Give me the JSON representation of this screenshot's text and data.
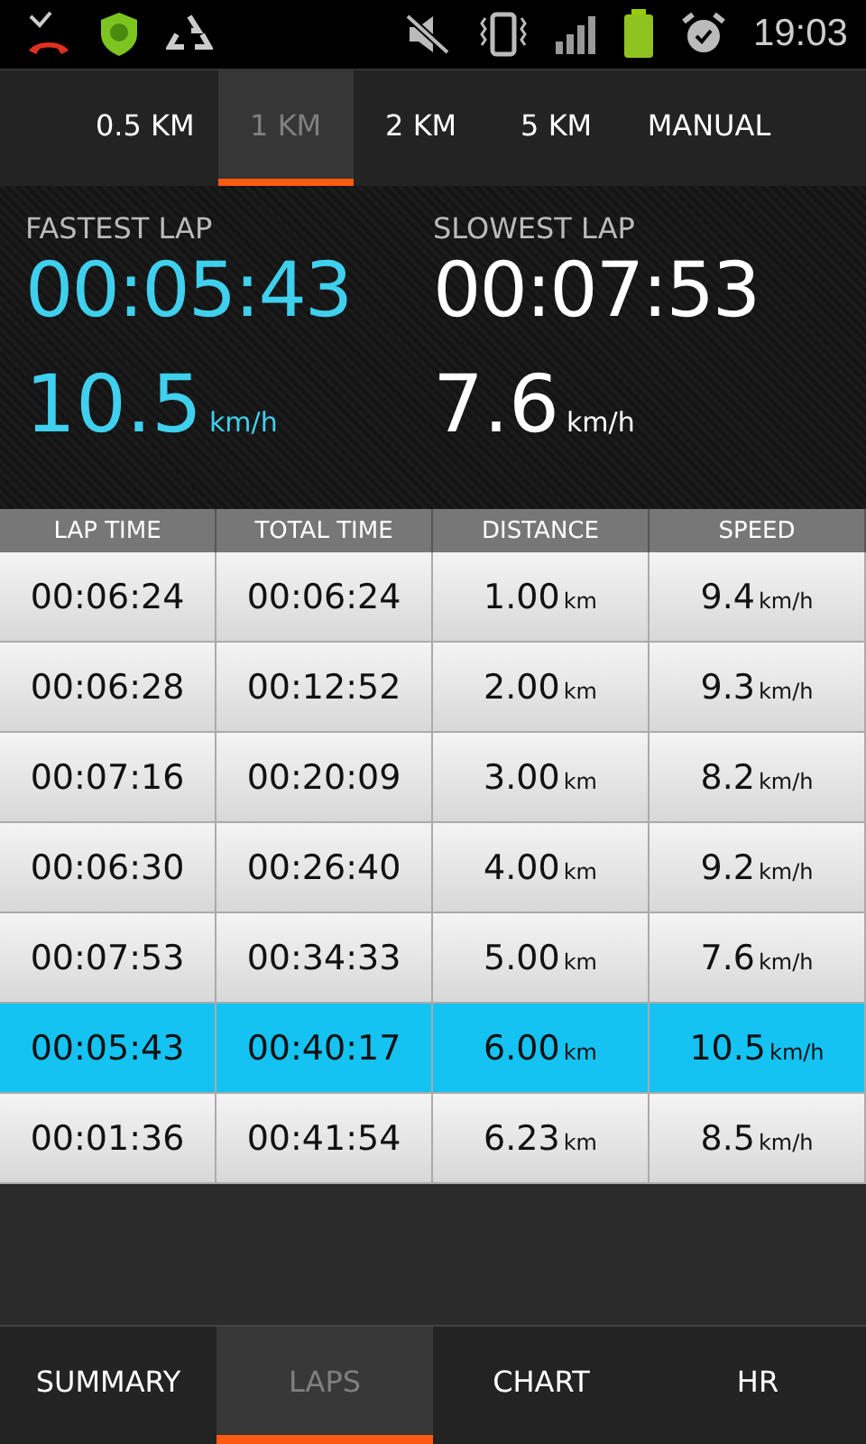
{
  "status_bar": {
    "time": "19:03"
  },
  "distance_tabs": [
    {
      "label": "0.5 KM",
      "selected": false
    },
    {
      "label": "1 KM",
      "selected": true
    },
    {
      "label": "2 KM",
      "selected": false
    },
    {
      "label": "5 KM",
      "selected": false
    },
    {
      "label": "MANUAL",
      "selected": false
    }
  ],
  "stats": [
    {
      "kind": "fastest",
      "title": "FASTEST LAP",
      "time": "00:05:43",
      "speed": "10.5",
      "unit": "km/h"
    },
    {
      "kind": "slowest",
      "title": "SLOWEST LAP",
      "time": "00:07:53",
      "speed": "7.6",
      "unit": "km/h"
    }
  ],
  "table": {
    "columns": [
      "LAP TIME",
      "TOTAL TIME",
      "DISTANCE",
      "SPEED"
    ],
    "rows": [
      {
        "lap_time": "00:06:24",
        "total_time": "00:06:24",
        "distance": "1.00",
        "distance_unit": "km",
        "speed": "9.4",
        "speed_unit": "km/h",
        "selected": false
      },
      {
        "lap_time": "00:06:28",
        "total_time": "00:12:52",
        "distance": "2.00",
        "distance_unit": "km",
        "speed": "9.3",
        "speed_unit": "km/h",
        "selected": false
      },
      {
        "lap_time": "00:07:16",
        "total_time": "00:20:09",
        "distance": "3.00",
        "distance_unit": "km",
        "speed": "8.2",
        "speed_unit": "km/h",
        "selected": false
      },
      {
        "lap_time": "00:06:30",
        "total_time": "00:26:40",
        "distance": "4.00",
        "distance_unit": "km",
        "speed": "9.2",
        "speed_unit": "km/h",
        "selected": false
      },
      {
        "lap_time": "00:07:53",
        "total_time": "00:34:33",
        "distance": "5.00",
        "distance_unit": "km",
        "speed": "7.6",
        "speed_unit": "km/h",
        "selected": false
      },
      {
        "lap_time": "00:05:43",
        "total_time": "00:40:17",
        "distance": "6.00",
        "distance_unit": "km",
        "speed": "10.5",
        "speed_unit": "km/h",
        "selected": true
      },
      {
        "lap_time": "00:01:36",
        "total_time": "00:41:54",
        "distance": "6.23",
        "distance_unit": "km",
        "speed": "8.5",
        "speed_unit": "km/h",
        "selected": false
      }
    ]
  },
  "bottom_tabs": [
    {
      "label": "SUMMARY",
      "selected": false
    },
    {
      "label": "LAPS",
      "selected": true
    },
    {
      "label": "CHART",
      "selected": false
    },
    {
      "label": "HR",
      "selected": false
    }
  ]
}
